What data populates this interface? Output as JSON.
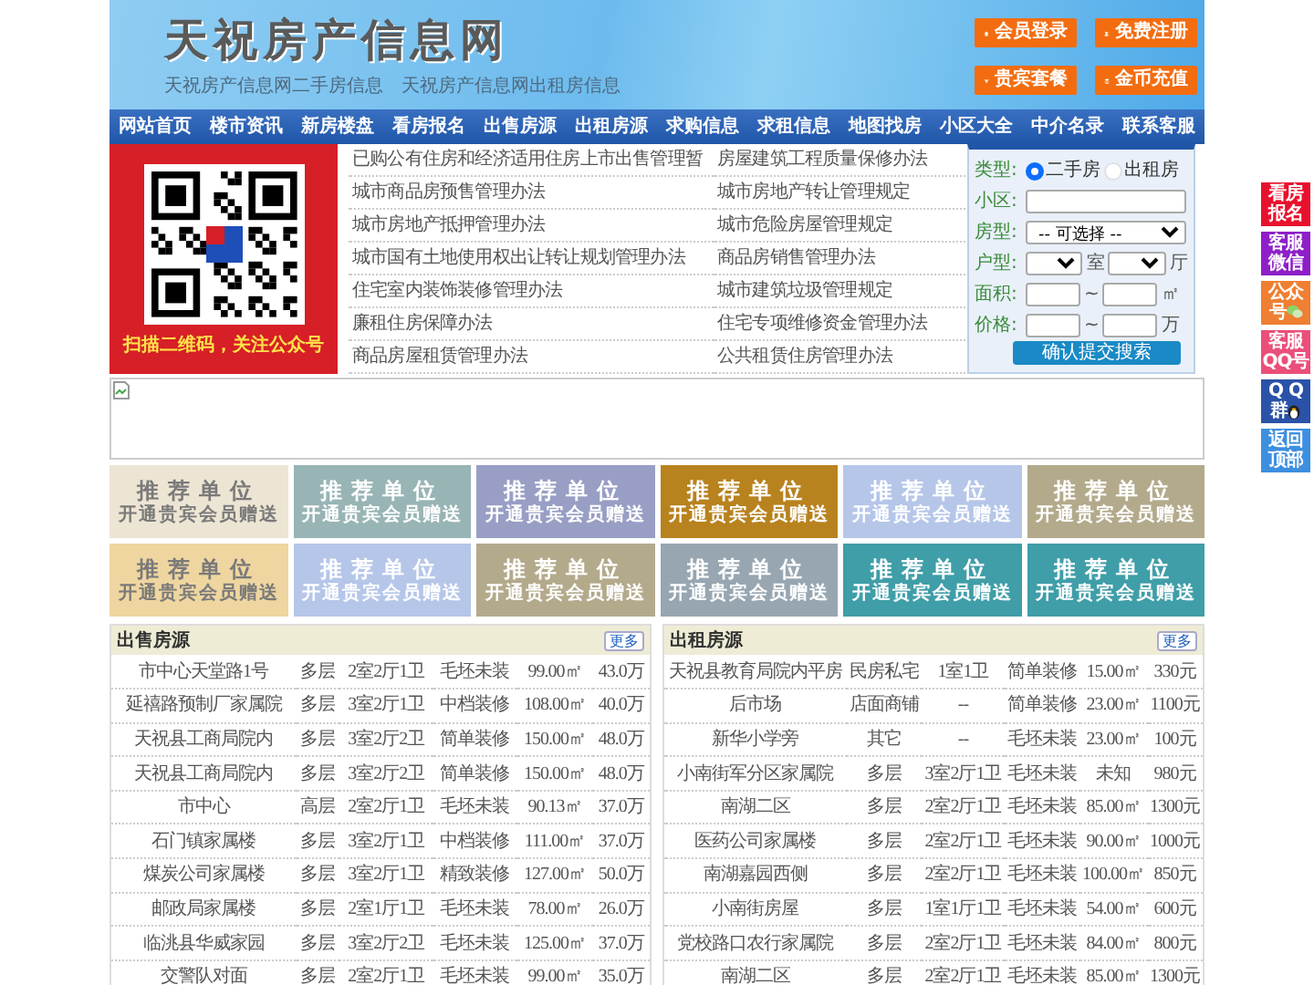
{
  "header": {
    "title": "天祝房产信息网",
    "links": [
      "天祝房产信息网二手房信息",
      "天祝房产信息网出租房信息"
    ],
    "buttons": [
      {
        "label": "会员登录",
        "kind": "home"
      },
      {
        "label": "免费注册",
        "kind": "user"
      },
      {
        "label": "贵宾套餐",
        "kind": "vip"
      },
      {
        "label": "金币充值",
        "kind": "coins"
      }
    ]
  },
  "nav": [
    "网站首页",
    "楼市资讯",
    "新房楼盘",
    "看房报名",
    "出售房源",
    "出租房源",
    "求购信息",
    "求租信息",
    "地图找房",
    "小区大全",
    "中介名录",
    "联系客服"
  ],
  "qr_banner": {
    "caption": "扫描二维码，关注公众号"
  },
  "policies": [
    "已购公有住房和经济适用住房上市出售管理暂",
    "房屋建筑工程质量保修办法",
    "城市商品房预售管理办法",
    "城市房地产转让管理规定",
    "城市房地产抵押管理办法",
    "城市危险房屋管理规定",
    "城市国有土地使用权出让转让规划管理办法",
    "商品房销售管理办法",
    "住宅室内装饰装修管理办法",
    "城市建筑垃圾管理规定",
    "廉租住房保障办法",
    "住宅专项维修资金管理办法",
    "商品房屋租赁管理办法",
    "公共租赁住房管理办法"
  ],
  "search": {
    "rows": [
      {
        "kind": "radio",
        "label": "类型:",
        "options": [
          {
            "label": "二手房",
            "selected": true
          },
          {
            "label": "出租房",
            "selected": false
          }
        ]
      },
      {
        "kind": "text",
        "label": "小区:"
      },
      {
        "kind": "select",
        "label": "房型:",
        "value": "-- 可选择 --"
      },
      {
        "kind": "pair",
        "label": "户型:",
        "units": [
          "室",
          "厅"
        ]
      },
      {
        "kind": "range",
        "label": "面积:",
        "sep": "~",
        "unit": "㎡"
      },
      {
        "kind": "range",
        "label": "价格:",
        "sep": "~",
        "unit": "万"
      }
    ],
    "submit": "确认提交搜索"
  },
  "tiles": [
    {
      "title": "推荐单位",
      "subtitle": "开通贵宾会员赠送",
      "color": "#ede5d3"
    },
    {
      "title": "推荐单位",
      "subtitle": "开通贵宾会员赠送",
      "color": "#98b4b4"
    },
    {
      "title": "推荐单位",
      "subtitle": "开通贵宾会员赠送",
      "color": "#989ec4"
    },
    {
      "title": "推荐单位",
      "subtitle": "开通贵宾会员赠送",
      "color": "#b8821e"
    },
    {
      "title": "推荐单位",
      "subtitle": "开通贵宾会员赠送",
      "color": "#b5c6e9"
    },
    {
      "title": "推荐单位",
      "subtitle": "开通贵宾会员赠送",
      "color": "#b3aa8c"
    },
    {
      "title": "推荐单位",
      "subtitle": "开通贵宾会员赠送",
      "color": "#efd6a0"
    },
    {
      "title": "推荐单位",
      "subtitle": "开通贵宾会员赠送",
      "color": "#b5c6e9"
    },
    {
      "title": "推荐单位",
      "subtitle": "开通贵宾会员赠送",
      "color": "#b3aa8c"
    },
    {
      "title": "推荐单位",
      "subtitle": "开通贵宾会员赠送",
      "color": "#97a6b1"
    },
    {
      "title": "推荐单位",
      "subtitle": "开通贵宾会员赠送",
      "color": "#3f9ea8"
    },
    {
      "title": "推荐单位",
      "subtitle": "开通贵宾会员赠送",
      "color": "#3f9ea8"
    }
  ],
  "listings": [
    {
      "title": "出售房源",
      "more": "更多",
      "rows": [
        [
          "市中心天堂路1号",
          "多层",
          "2室2厅1卫",
          "毛坯未装",
          "99.00㎡",
          "43.0万"
        ],
        [
          "延禧路预制厂家属院",
          "多层",
          "3室2厅1卫",
          "中档装修",
          "108.00㎡",
          "40.0万"
        ],
        [
          "天祝县工商局院内",
          "多层",
          "3室2厅2卫",
          "简单装修",
          "150.00㎡",
          "48.0万"
        ],
        [
          "天祝县工商局院内",
          "多层",
          "3室2厅2卫",
          "简单装修",
          "150.00㎡",
          "48.0万"
        ],
        [
          "市中心",
          "高层",
          "2室2厅1卫",
          "毛坯未装",
          "90.13㎡",
          "37.0万"
        ],
        [
          "石门镇家属楼",
          "多层",
          "3室2厅1卫",
          "中档装修",
          "111.00㎡",
          "37.0万"
        ],
        [
          "煤炭公司家属楼",
          "多层",
          "3室2厅1卫",
          "精致装修",
          "127.00㎡",
          "50.0万"
        ],
        [
          "邮政局家属楼",
          "多层",
          "2室1厅1卫",
          "毛坯未装",
          "78.00㎡",
          "26.0万"
        ],
        [
          "临洮县华威家园",
          "多层",
          "3室2厅2卫",
          "毛坯未装",
          "125.00㎡",
          "37.0万"
        ],
        [
          "交警队对面",
          "多层",
          "2室2厅1卫",
          "毛坯未装",
          "99.00㎡",
          "35.0万"
        ]
      ]
    },
    {
      "title": "出租房源",
      "more": "更多",
      "rows": [
        [
          "天祝县教育局院内平房",
          "民房私宅",
          "1室1卫",
          "简单装修",
          "15.00㎡",
          "330元"
        ],
        [
          "后市场",
          "店面商铺",
          "--",
          "简单装修",
          "23.00㎡",
          "1100元"
        ],
        [
          "新华小学旁",
          "其它",
          "--",
          "毛坯未装",
          "23.00㎡",
          "100元"
        ],
        [
          "小南街军分区家属院",
          "多层",
          "3室2厅1卫",
          "毛坯未装",
          "未知",
          "980元"
        ],
        [
          "南湖二区",
          "多层",
          "2室2厅1卫",
          "毛坯未装",
          "85.00㎡",
          "1300元"
        ],
        [
          "医药公司家属楼",
          "多层",
          "2室2厅1卫",
          "毛坯未装",
          "90.00㎡",
          "1000元"
        ],
        [
          "南湖嘉园西侧",
          "多层",
          "2室2厅1卫",
          "毛坯未装",
          "100.00㎡",
          "850元"
        ],
        [
          "小南街房屋",
          "多层",
          "1室1厅1卫",
          "毛坯未装",
          "54.00㎡",
          "600元"
        ],
        [
          "党校路口农行家属院",
          "多层",
          "2室2厅1卫",
          "毛坯未装",
          "84.00㎡",
          "800元"
        ],
        [
          "南湖二区",
          "多层",
          "2室2厅1卫",
          "毛坯未装",
          "85.00㎡",
          "1300元"
        ]
      ]
    }
  ],
  "side_buttons": [
    {
      "lines": [
        "看房",
        "报名"
      ],
      "color": "#e8112d"
    },
    {
      "lines": [
        "客服",
        "微信"
      ],
      "color": "#8e1fc8"
    },
    {
      "lines": [
        "公众",
        "号"
      ],
      "color": "#ef7f32",
      "kind": "wechat"
    },
    {
      "lines": [
        "客服",
        "QQ号"
      ],
      "color": "#ea4f7a"
    },
    {
      "lines": [
        "Q Q",
        "群"
      ],
      "color": "#2a52a8",
      "kind": "penguin"
    },
    {
      "lines": [
        "返回",
        "顶部"
      ],
      "color": "#3d8fe0"
    }
  ]
}
